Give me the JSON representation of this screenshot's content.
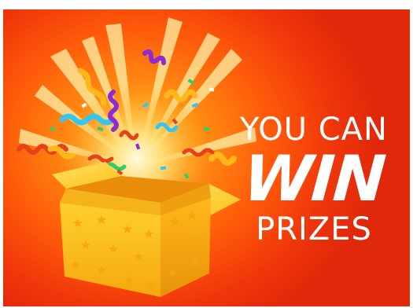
{
  "promo": {
    "line1": "YOU CAN",
    "line2": "WIN",
    "line3": "PRIZES"
  },
  "colors": {
    "background_center": "#ffd25a",
    "background_edge": "#e0280a",
    "box": "#ffc21a",
    "text": "#ffffff"
  },
  "icons": {
    "gift_box": "open-gift-box-icon",
    "confetti": "confetti-icon",
    "star": "star-icon"
  }
}
